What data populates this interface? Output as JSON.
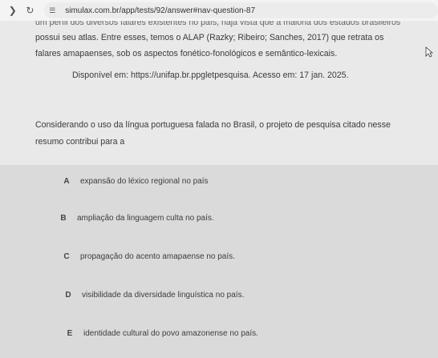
{
  "browser": {
    "url": "simulax.com.br/app/tests/92/answer#nav-question-87",
    "back_icon": "arrow-left",
    "reload_icon": "reload"
  },
  "text": {
    "cut_line": "um perfil dos diversos falares existentes no país, haja vista que a maioria dos estados brasileiros",
    "line1": "possui seu atlas. Entre esses, temos o ALAP (Razky; Ribeiro; Sanches, 2017) que retrata os",
    "line2": "falares amapaenses, sob os aspectos fonético-fonológicos e semântico-lexicais.",
    "source": "Disponível em: https://unifap.br.ppgletpesquisa. Acesso em: 17 jan. 2025.",
    "question_line1": "Considerando o uso da língua portuguesa falada no Brasil, o projeto de pesquisa citado nesse",
    "question_line2": "resumo contribui para a"
  },
  "options": [
    {
      "letter": "A",
      "text": "expansão do léxico regional no país"
    },
    {
      "letter": "B",
      "text": "ampliação da linguagem culta no país."
    },
    {
      "letter": "C",
      "text": "propagação do acento amapaense no país."
    },
    {
      "letter": "D",
      "text": "visibilidade da diversidade linguística no país."
    },
    {
      "letter": "E",
      "text": "identidade cultural do povo amazonense no país."
    }
  ]
}
